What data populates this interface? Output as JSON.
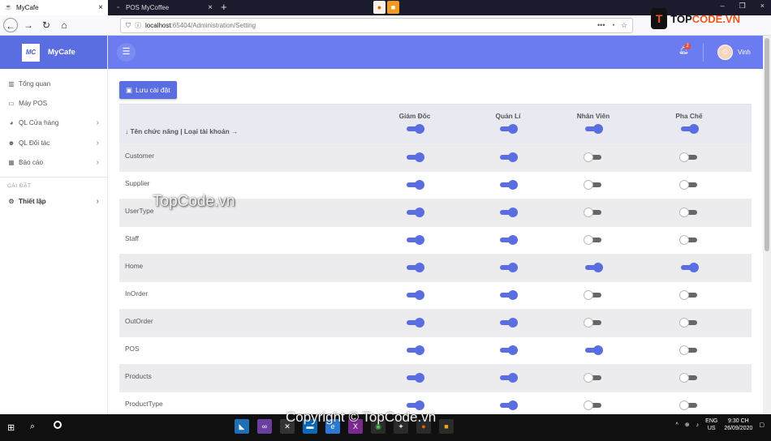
{
  "browser": {
    "tabs": [
      {
        "title": "MyCafe",
        "favicon": "coffee-favicon"
      },
      {
        "title": "POS MyCoffee",
        "favicon": "page-favicon"
      }
    ],
    "url_host": "localhost",
    "url_path": ":65404/Administration/Setting"
  },
  "brandmark": {
    "left": "T",
    "text1": "TOP",
    "text2": "CODE.VN"
  },
  "sidebar": {
    "brand": "MyCafe",
    "brand_mark": "MC",
    "items": [
      {
        "label": "Tổng quan",
        "icon": "chart-icon"
      },
      {
        "label": "Máy POS",
        "icon": "monitor-icon"
      },
      {
        "label": "QL Cửa hàng",
        "icon": "pie-chart-icon",
        "chevron": true
      },
      {
        "label": "QL Đối tác",
        "icon": "users-icon",
        "chevron": true
      },
      {
        "label": "Báo cáo",
        "icon": "table-icon",
        "chevron": true
      }
    ],
    "section_heading": "CÀI ĐẶT",
    "settings_item": {
      "label": "Thiết lập",
      "icon": "gear-icon"
    }
  },
  "topbar": {
    "notification_count": "2",
    "user_name": "Vinh"
  },
  "main": {
    "save_label": "Lưu cài đặt",
    "header_first": "↓ Tên chức năng | Loại tài khoản →",
    "roles": [
      "Giám Đốc",
      "Quản Lí",
      "Nhân Viên",
      "Pha Chế"
    ],
    "header_toggles": [
      true,
      true,
      true,
      true
    ],
    "rows": [
      {
        "name": "Customer",
        "perms": [
          true,
          true,
          false,
          false
        ]
      },
      {
        "name": "Supplier",
        "perms": [
          true,
          true,
          false,
          false
        ]
      },
      {
        "name": "UserType",
        "perms": [
          true,
          true,
          false,
          false
        ]
      },
      {
        "name": "Staff",
        "perms": [
          true,
          true,
          false,
          false
        ]
      },
      {
        "name": "Home",
        "perms": [
          true,
          true,
          true,
          true
        ]
      },
      {
        "name": "InOrder",
        "perms": [
          true,
          true,
          false,
          false
        ]
      },
      {
        "name": "OutOrder",
        "perms": [
          true,
          true,
          false,
          false
        ]
      },
      {
        "name": "POS",
        "perms": [
          true,
          true,
          true,
          false
        ]
      },
      {
        "name": "Products",
        "perms": [
          true,
          true,
          false,
          false
        ]
      },
      {
        "name": "ProductType",
        "perms": [
          true,
          true,
          false,
          false
        ]
      }
    ]
  },
  "watermark": "TopCode.vn",
  "watermark_bottom": "Copyright © TopCode.vn",
  "taskbar": {
    "lang1": "ENG",
    "lang2": "US",
    "time": "9:30 CH",
    "date": "26/09/2020"
  },
  "colors": {
    "accent": "#5a6de1",
    "topbar": "#6a7cf0"
  }
}
